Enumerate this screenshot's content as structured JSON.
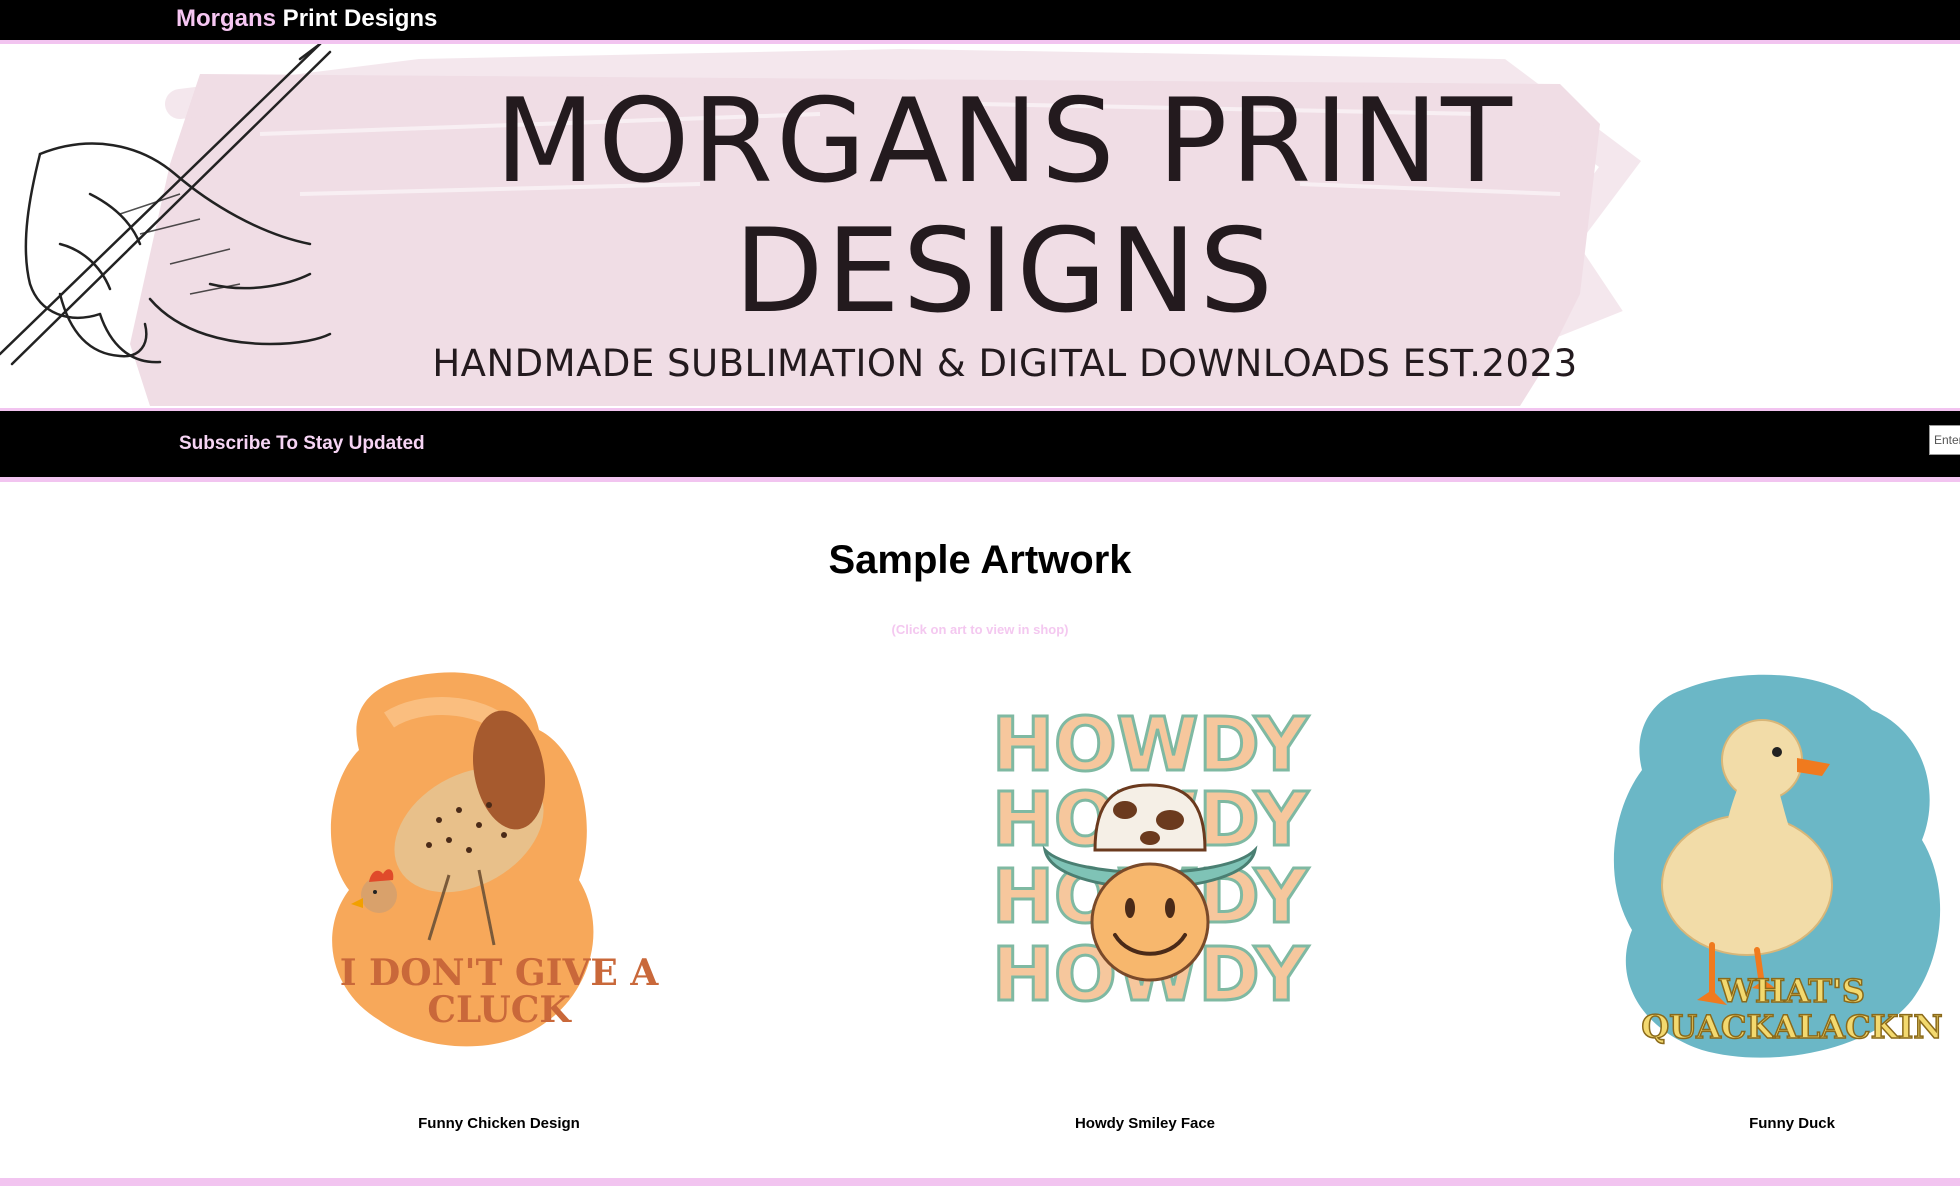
{
  "header": {
    "brand_first": "Morgans",
    "brand_rest": " Print Designs"
  },
  "banner": {
    "title_line1": "MORGANS PRINT",
    "title_line2": "DESIGNS",
    "tagline": "HANDMADE SUBLIMATION & DIGITAL DOWNLOADS EST.2023"
  },
  "subscribe": {
    "label": "Subscribe To Stay Updated",
    "input_value": "Enter"
  },
  "main": {
    "title": "Sample Artwork",
    "subtitle": "(Click on art to view in shop)",
    "cards": [
      {
        "caption": "Funny Chicken Design",
        "art_text_line1": "I DON'T GIVE A",
        "art_text_line2": "CLUCK"
      },
      {
        "caption": "Howdy Smiley Face",
        "art_text": "HOWDY"
      },
      {
        "caption": "Funny Duck",
        "art_text_line1": "WHAT'S",
        "art_text_line2": "QUACKALACKIN"
      }
    ]
  },
  "colors": {
    "accent_pink": "#f2c4f0",
    "bar_black": "#000000",
    "banner_brush": "#f0dde5",
    "chicken_bg": "#f7a85a",
    "duck_bg": "#6bb7c6",
    "howdy_letters": "#f6c79d"
  }
}
